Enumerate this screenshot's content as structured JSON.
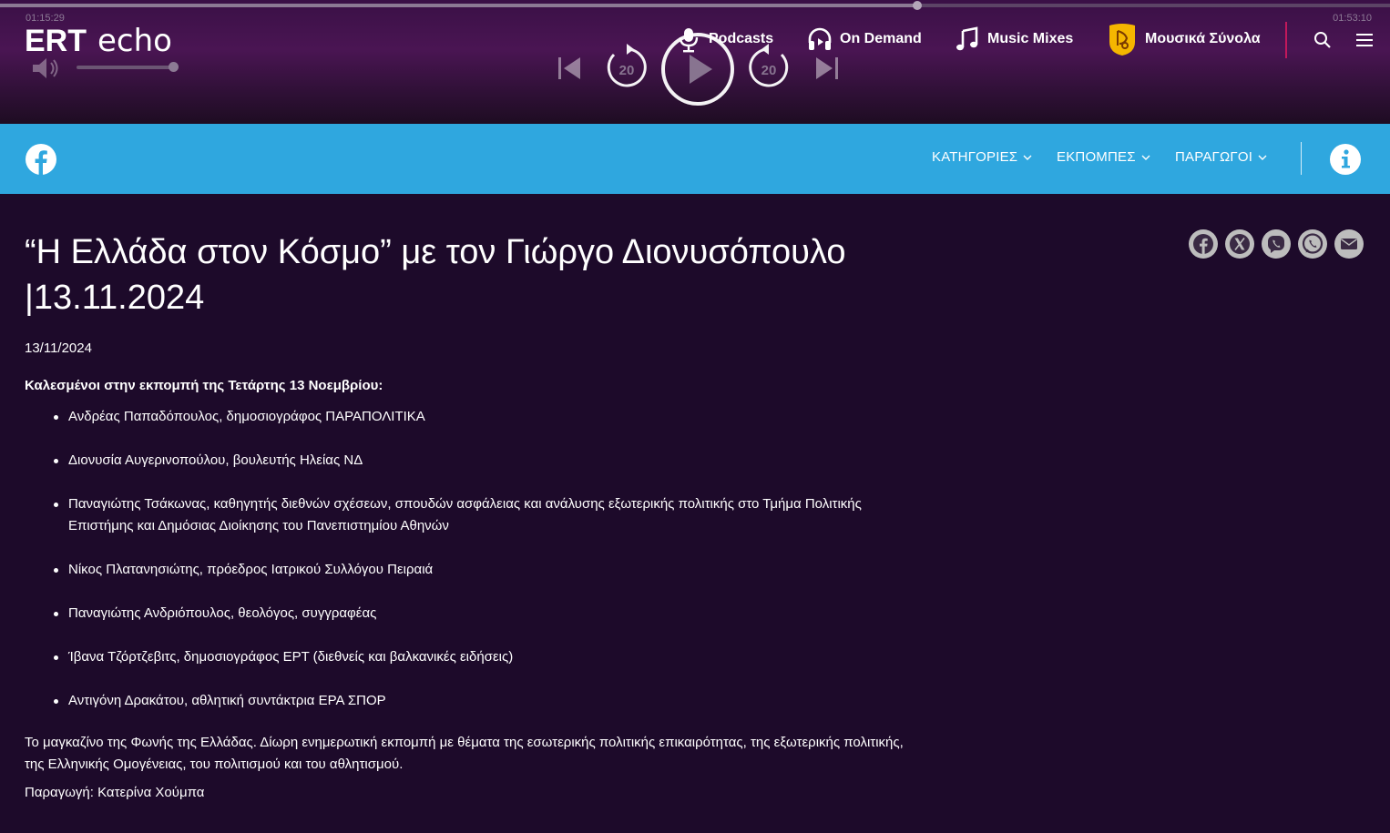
{
  "player": {
    "elapsed": "01:15:29",
    "duration": "01:53:10",
    "progress": 0.66,
    "volume": 1.0,
    "skip_back_seconds": "20",
    "skip_forward_seconds": "20"
  },
  "logo": {
    "text_bold": "ERT",
    "text_script": "echo"
  },
  "nav": {
    "podcasts": "Podcasts",
    "on_demand": "On Demand",
    "music_mixes": "Music Mixes",
    "synola": "Μουσικά Σύνολα"
  },
  "category_bar": {
    "menus": [
      "ΚΑΤΗΓΟΡΙΕΣ",
      "ΕΚΠΟΜΠΕΣ",
      "ΠΑΡΑΓΩΓΟΙ"
    ]
  },
  "article": {
    "title": "“Η Ελλάδα στον Κόσμο” με τον Γιώργο Διονυσόπουλο |13.11.2024",
    "date": "13/11/2024",
    "guests_heading": "Καλεσμένοι στην εκπομπή της Τετάρτης 13 Νοεμβρίου:",
    "guests": [
      "Ανδρέας Παπαδόπουλος, δημοσιογράφος ΠΑΡΑΠΟΛΙΤΙΚΑ",
      "Διονυσία Αυγερινοπούλου, βουλευτής Ηλείας ΝΔ",
      "Παναγιώτης Τσάκωνας, καθηγητής διεθνών σχέσεων, σπουδών ασφάλειας και ανάλυσης εξωτερικής πολιτικής στο Τμήμα Πολιτικής Επιστήμης και Δημόσιας Διοίκησης του Πανεπιστημίου Αθηνών",
      "Νίκος Πλατανησιώτης, πρόεδρος Ιατρικού Συλλόγου Πειραιά",
      "Παναγιώτης Ανδριόπουλος, θεολόγος, συγγραφέας",
      "Ίβανα Τζόρτζεβιτς, δημοσιογράφος ΕΡΤ (διεθνείς και βαλκανικές ειδήσεις)",
      "Αντιγόνη Δρακάτου, αθλητική συντάκτρια ΕΡΑ ΣΠΟΡ"
    ],
    "description": "Το μαγκαζίνο της Φωνής της Ελλάδας. Δίωρη ενημερωτική εκπομπή με θέματα της εσωτερικής πολιτικής επικαιρότητας, της εξωτερικής πολιτικής, της Ελληνικής Ομογένειας, του πολιτισμού και του αθλητισμού.",
    "producer": "Παραγωγή: Κατερίνα Χούμπα"
  },
  "share": {
    "icons": [
      "facebook-icon",
      "x-icon",
      "viber-icon",
      "whatsapp-icon",
      "email-icon"
    ]
  },
  "colors": {
    "page_bg": "#1d0a2a",
    "category_bar": "#2fa7df",
    "separator_accent": "#c2185b",
    "synola_badge": "#f5b600"
  }
}
